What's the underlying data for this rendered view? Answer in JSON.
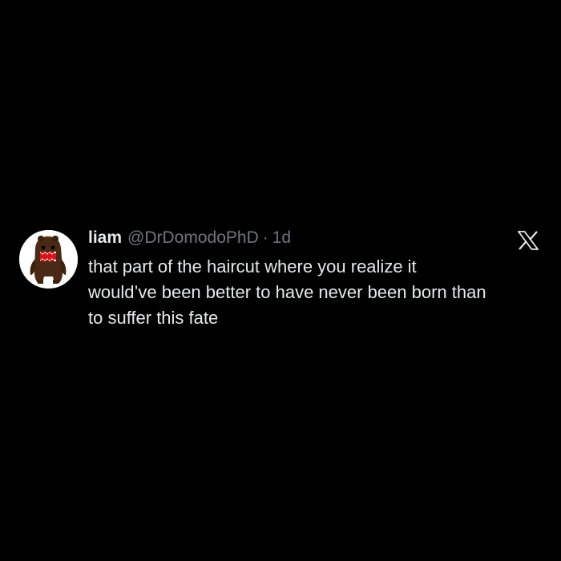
{
  "tweet": {
    "display_name": "liam",
    "handle": "@DrDomodoPhD",
    "separator": "·",
    "timestamp": "1d",
    "text_lines": [
      "that part of the haircut where you realize it",
      "would’ve been better to have never been born than",
      "to suffer this fate"
    ]
  },
  "icons": {
    "avatar": "domo-plush-avatar",
    "platform": "x-logo-icon"
  },
  "colors": {
    "background": "#000000",
    "primary_text": "#e7e9ea",
    "secondary_text": "#71767b"
  }
}
